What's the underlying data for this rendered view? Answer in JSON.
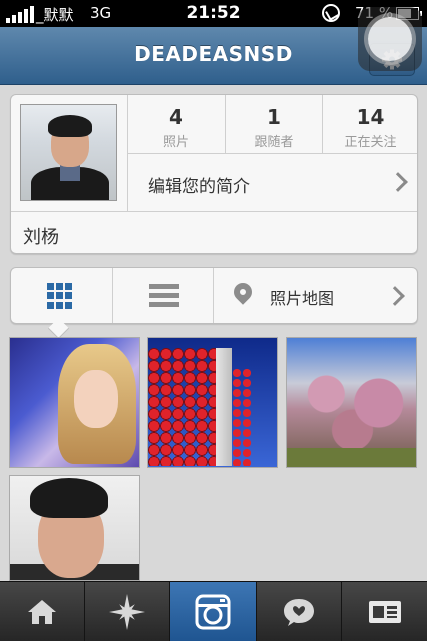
{
  "status_bar": {
    "carrier": "_默默",
    "network": "3G",
    "time": "21:52",
    "battery": "71 %",
    "battery_level": 0.71
  },
  "nav": {
    "title": "DEADEASNSD"
  },
  "profile": {
    "stats": [
      {
        "value": "4",
        "label": "照片"
      },
      {
        "value": "1",
        "label": "跟随者"
      },
      {
        "value": "14",
        "label": "正在关注"
      }
    ],
    "edit_label": "编辑您的简介",
    "name": "刘杨"
  },
  "view_bar": {
    "map_label": "照片地图",
    "active": "grid"
  },
  "tab_bar": {
    "active": "profile",
    "items": [
      "home-icon",
      "explore-icon",
      "camera-icon",
      "news-icon",
      "profile-icon"
    ]
  },
  "colors": {
    "nav_top": "#5f88ad",
    "nav_bottom": "#2f5f8c",
    "accent": "#2b6aa6",
    "tab_active": "#3d76b4"
  }
}
